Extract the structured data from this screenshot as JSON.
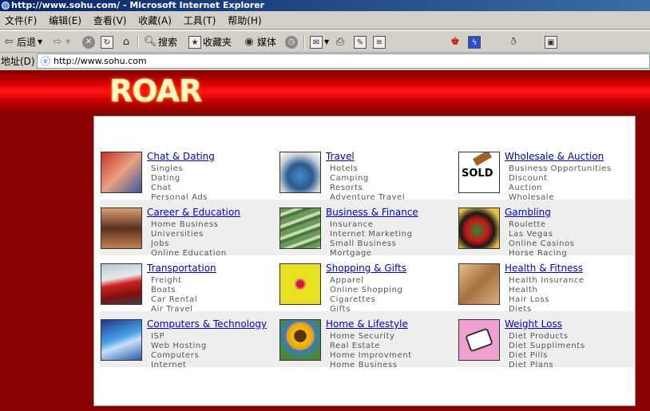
{
  "window": {
    "title": "http://www.sohu.com/ - Microsoft Internet Explorer"
  },
  "menubar": {
    "items": [
      "文件(F)",
      "编辑(E)",
      "查看(V)",
      "收藏(A)",
      "工具(T)",
      "帮助(H)"
    ]
  },
  "toolbar": {
    "back_label": "后退",
    "search_label": "搜索",
    "favorites_label": "收藏夹",
    "media_label": "媒体"
  },
  "address": {
    "label": "地址(D)",
    "url": "http://www.sohu.com"
  },
  "page": {
    "logo_text": "ROAR",
    "categories": [
      {
        "title": "Chat & Dating",
        "items": [
          "Singles",
          "Dating",
          "Chat",
          "Personal Ads"
        ]
      },
      {
        "title": "Travel",
        "items": [
          "Hotels",
          "Camping",
          "Resorts",
          "Adventure Travel"
        ]
      },
      {
        "title": "Wholesale & Auction",
        "items": [
          "Business Opportunities",
          "Discount",
          "Auction",
          "Wholesale"
        ],
        "image_text": "SOLD"
      },
      {
        "title": "Career & Education",
        "items": [
          "Home Business",
          "Universities",
          "Jobs",
          "Online Education"
        ]
      },
      {
        "title": "Business & Finance",
        "items": [
          "Insurance",
          "Internet Marketing",
          "Small Business",
          "Mortgage"
        ]
      },
      {
        "title": "Gambling",
        "items": [
          "Roulette",
          "Las Vegas",
          "Online Casinos",
          "Horse Racing"
        ]
      },
      {
        "title": "Transportation",
        "items": [
          "Freight",
          "Boats",
          "Car Rental",
          "Air Travel"
        ]
      },
      {
        "title": "Shopping & Gifts",
        "items": [
          "Apparel",
          "Online Shopping",
          "Cigarettes",
          "Gifts"
        ]
      },
      {
        "title": "Health & Fitness",
        "items": [
          "Health Insurance",
          "Health",
          "Hair Loss",
          "Diets"
        ]
      },
      {
        "title": "Computers & Technology",
        "items": [
          "ISP",
          "Web Hosting",
          "Computers",
          "Internet"
        ]
      },
      {
        "title": "Home & Lifestyle",
        "items": [
          "Home Security",
          "Real Estate",
          "Home Improvment",
          "Home Business"
        ]
      },
      {
        "title": "Weight Loss",
        "items": [
          "Diet Products",
          "Diet Suppliments",
          "Diet Pills",
          "Diet Plans"
        ]
      }
    ]
  }
}
